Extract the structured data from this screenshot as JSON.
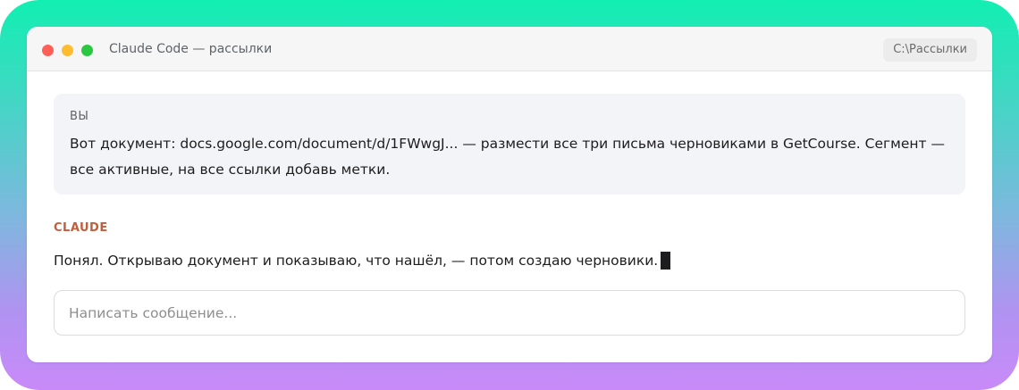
{
  "window": {
    "title": "Claude Code — рассылки",
    "path": "C:\\Рассылки"
  },
  "colors": {
    "close": "#ff5f57",
    "minimize": "#febc2e",
    "maximize": "#28c840",
    "accent": "#c15f3c"
  },
  "chat": {
    "user": {
      "label": "ВЫ",
      "text": "Вот документ: docs.google.com/document/d/1FWwgJ... — размести все три письма черновиками в GetCourse. Сегмент — все активные, на все ссылки добавь метки."
    },
    "assistant": {
      "label": "CLAUDE",
      "text": "Понял. Открываю документ и показываю, что нашёл, — потом создаю черновики."
    }
  },
  "composer": {
    "placeholder": "Написать сообщение...",
    "value": ""
  }
}
